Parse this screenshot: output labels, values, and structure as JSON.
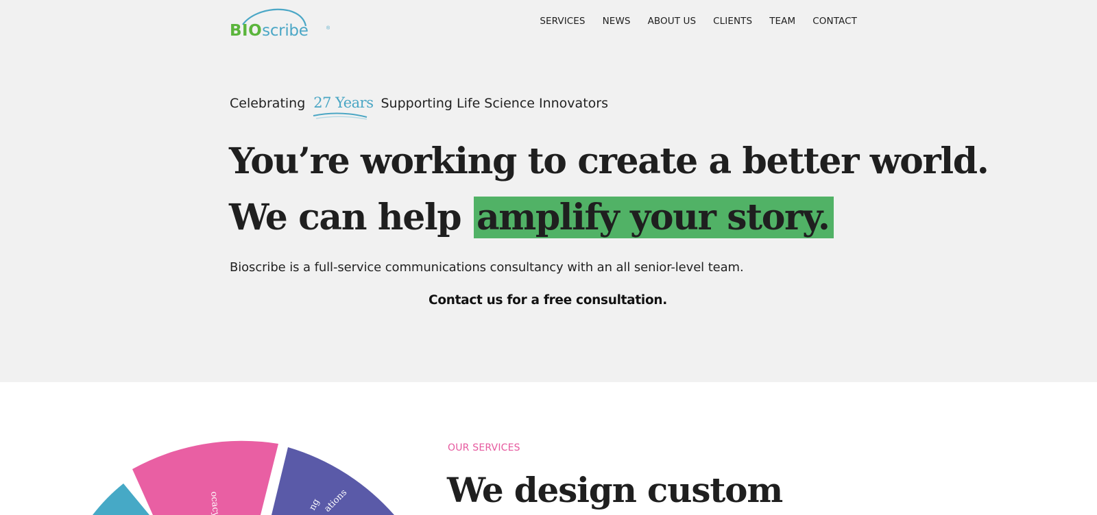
{
  "brand": {
    "logo_bio": "BIO",
    "logo_scribe": "scribe",
    "logo_reg": "®",
    "green": "#5bb53c",
    "blue": "#4ba7c6"
  },
  "nav": {
    "items": [
      "SERVICES",
      "NEWS",
      "ABOUT US",
      "CLIENTS",
      "TEAM",
      "CONTACT"
    ]
  },
  "hero": {
    "celebrate_prefix": "Celebrating",
    "years": "27 Years",
    "celebrate_suffix": "Supporting Life Science Innovators",
    "headline_line1": "You’re working to create a better world.",
    "headline_line2_plain": "We can help",
    "headline_line2_highlight": "amplify your story.",
    "highlight_color": "#51b266",
    "intro": "Bioscribe is a full-service communications consultancy with an all senior-level team.",
    "cta": "Contact us for a free consultation."
  },
  "services": {
    "eyebrow": "OUR SERVICES",
    "title": "We design custom",
    "wheel_labels": [
      "ocacy",
      "ng",
      "ations"
    ],
    "wheel_colors": [
      "#e95fa3",
      "#5a5aa8",
      "#46a9c6"
    ]
  }
}
